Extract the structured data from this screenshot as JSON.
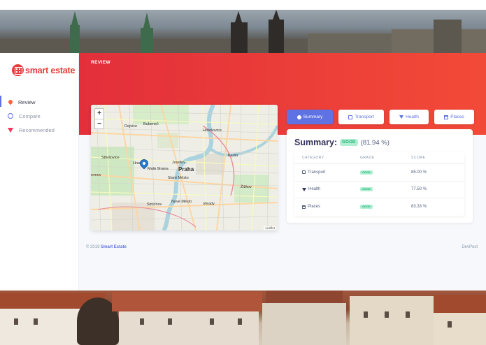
{
  "brand": {
    "name": "smart estate"
  },
  "sidebar": {
    "items": [
      {
        "label": "Review",
        "icon": "pin-icon",
        "active": true
      },
      {
        "label": "Compare",
        "icon": "compass-icon",
        "active": false
      },
      {
        "label": "Recommended",
        "icon": "gem-icon",
        "active": false
      }
    ]
  },
  "header": {
    "title": "REVIEW"
  },
  "map": {
    "zoom_in": "+",
    "zoom_out": "−",
    "attribution": "Leaflet",
    "labels": {
      "dejvice": "Dejvice",
      "bubenec": "Bubeneč",
      "holesovice": "Holešovice",
      "karlin": "Karlín",
      "strelosova": "Střešovice",
      "hrad": "Hrad",
      "josefov": "Josefov",
      "praha": "Praha",
      "mala_strana": "Malá Strana",
      "stare_mesto": "Staré Město",
      "motol": "evnov",
      "smichov": "Smíchov",
      "nove_mesto": "Nové Město",
      "zizkov": "Žižkov",
      "vinohrady": "ohrady"
    }
  },
  "tabs": [
    {
      "label": "Summary",
      "icon": "dot-icon",
      "active": true
    },
    {
      "label": "Transport",
      "icon": "bus-icon",
      "active": false
    },
    {
      "label": "Health",
      "icon": "heart-icon",
      "active": false
    },
    {
      "label": "Places",
      "icon": "store-icon",
      "active": false
    }
  ],
  "summary": {
    "title": "Summary:",
    "grade": "GOOD",
    "score": "(81.94 %)",
    "columns": [
      "CATEGORY",
      "GRADE",
      "SCORE"
    ],
    "rows": [
      {
        "category": "Transport",
        "icon": "bus-icon",
        "grade": "GOOD",
        "score": "85.00 %"
      },
      {
        "category": "Health",
        "icon": "heart-icon",
        "grade": "GOOD",
        "score": "77.50 %"
      },
      {
        "category": "Places",
        "icon": "store-icon",
        "grade": "GOOD",
        "score": "83.33 %"
      }
    ]
  },
  "footer": {
    "copyright": "© 2019",
    "brand": "Smart Estate",
    "link": "DevPost"
  },
  "colors": {
    "primary": "#5e72e4",
    "hero_red": "#e32f3a",
    "success": "#1aae6f",
    "brand_red": "#e53b3b"
  }
}
